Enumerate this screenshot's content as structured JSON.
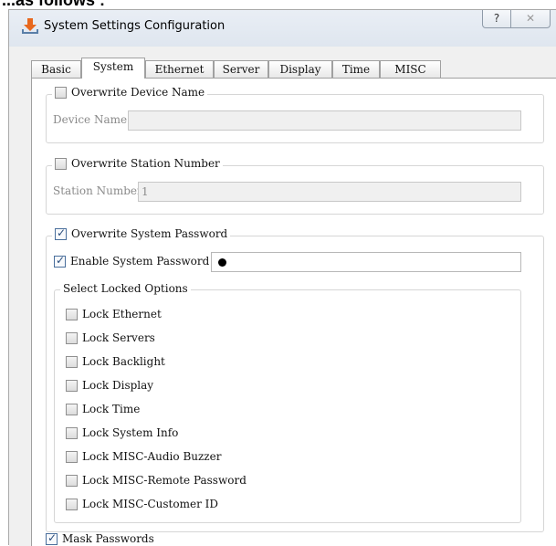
{
  "background_caption": "...as follows :",
  "window": {
    "title": "System Settings Configuration",
    "help_glyph": "?",
    "close_glyph": "✕"
  },
  "tabs": [
    {
      "label": "Basic",
      "active": false
    },
    {
      "label": "System",
      "active": true
    },
    {
      "label": "Ethernet",
      "active": false
    },
    {
      "label": "Server",
      "active": false
    },
    {
      "label": "Display",
      "active": false
    },
    {
      "label": "Time",
      "active": false
    },
    {
      "label": "MISC",
      "active": false
    }
  ],
  "device_name": {
    "checkbox_label": "Overwrite Device Name",
    "checked": false,
    "field_label": "Device Name",
    "value": ""
  },
  "station_number": {
    "checkbox_label": "Overwrite Station Number",
    "checked": false,
    "field_label": "Station Number",
    "value": "1"
  },
  "system_password": {
    "checkbox_label": "Overwrite System Password",
    "checked": true,
    "enable_label": "Enable System Password",
    "enable_checked": true,
    "password_masked": "●",
    "locked_options_title": "Select Locked Options",
    "locked_options": [
      {
        "label": "Lock Ethernet",
        "checked": false
      },
      {
        "label": "Lock Servers",
        "checked": false
      },
      {
        "label": "Lock Backlight",
        "checked": false
      },
      {
        "label": "Lock Display",
        "checked": false
      },
      {
        "label": "Lock Time",
        "checked": false
      },
      {
        "label": "Lock System Info",
        "checked": false
      },
      {
        "label": "Lock MISC-Audio Buzzer",
        "checked": false
      },
      {
        "label": "Lock MISC-Remote Password",
        "checked": false
      },
      {
        "label": "Lock MISC-Customer ID",
        "checked": false
      }
    ]
  },
  "mask_passwords": {
    "label": "Mask Passwords",
    "checked": true
  },
  "colors": {
    "app_icon": "#e8681e",
    "accent": "#2a4d7c"
  },
  "icons": {
    "app": "download-arrow-icon",
    "help": "help-icon",
    "close": "close-icon"
  }
}
